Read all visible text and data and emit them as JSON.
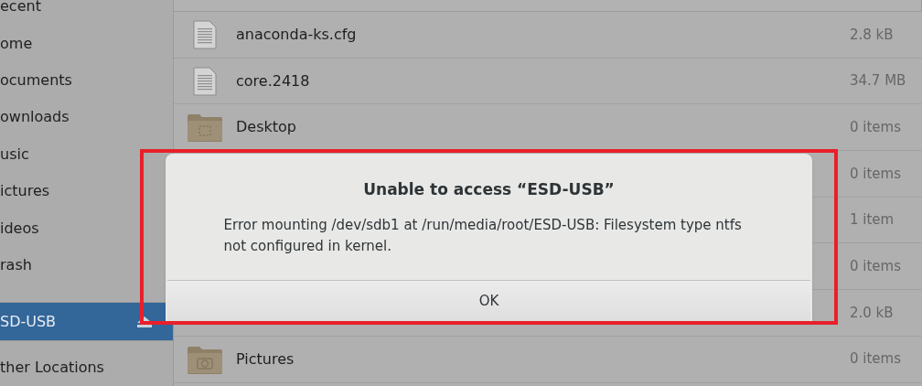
{
  "sidebar": {
    "items": [
      {
        "label": "ecent",
        "selected": false
      },
      {
        "label": "ome",
        "selected": false
      },
      {
        "label": "ocuments",
        "selected": false
      },
      {
        "label": "ownloads",
        "selected": false
      },
      {
        "label": "usic",
        "selected": false
      },
      {
        "label": "ictures",
        "selected": false
      },
      {
        "label": "ideos",
        "selected": false
      },
      {
        "label": "rash",
        "selected": false
      },
      {
        "label": "SD-USB",
        "selected": true,
        "kind": "device"
      },
      {
        "label": "ther Locations",
        "selected": false,
        "kind": "other"
      }
    ]
  },
  "files": {
    "rows": [
      {
        "kind": "file",
        "name": "anaconda-ks.cfg",
        "size": "2.8 kB"
      },
      {
        "kind": "file",
        "name": "core.2418",
        "size": "34.7 MB"
      },
      {
        "kind": "folder-desktop",
        "name": "Desktop",
        "size": "0 items"
      },
      {
        "kind": "hidden",
        "size": "0 items"
      },
      {
        "kind": "hidden",
        "size": "1 item"
      },
      {
        "kind": "hidden",
        "size": "0 items"
      },
      {
        "kind": "hidden",
        "size": "2.0 kB"
      },
      {
        "kind": "folder-pictures",
        "name": "Pictures",
        "size": "0 items"
      }
    ]
  },
  "dialog": {
    "title": "Unable to access “ESD-USB”",
    "message": "Error mounting /dev/sdb1 at /run/media/root/ESD-USB: Filesystem type ntfs not configured in kernel.",
    "buttons": [
      "OK"
    ],
    "highlighted": true
  }
}
